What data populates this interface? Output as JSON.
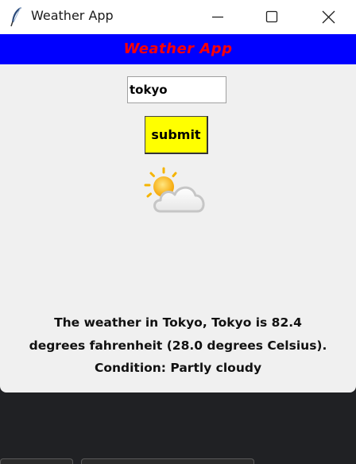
{
  "window": {
    "title": "Weather App",
    "icon": "feather-icon"
  },
  "controls": {
    "minimize_icon": "minimize-icon",
    "maximize_icon": "maximize-icon",
    "close_icon": "close-icon"
  },
  "banner": {
    "text": "Weather App",
    "background": "#0000ff",
    "color": "#ff0000"
  },
  "search": {
    "value": "tokyo"
  },
  "submit": {
    "label": "submit",
    "background": "#ffff00"
  },
  "weather": {
    "icon": "partly-cloudy-icon",
    "lines": [
      "The weather in Tokyo, Tokyo is 82.4",
      "degrees fahrenheit (28.0 degrees Celsius).",
      "Condition: Partly cloudy"
    ]
  }
}
